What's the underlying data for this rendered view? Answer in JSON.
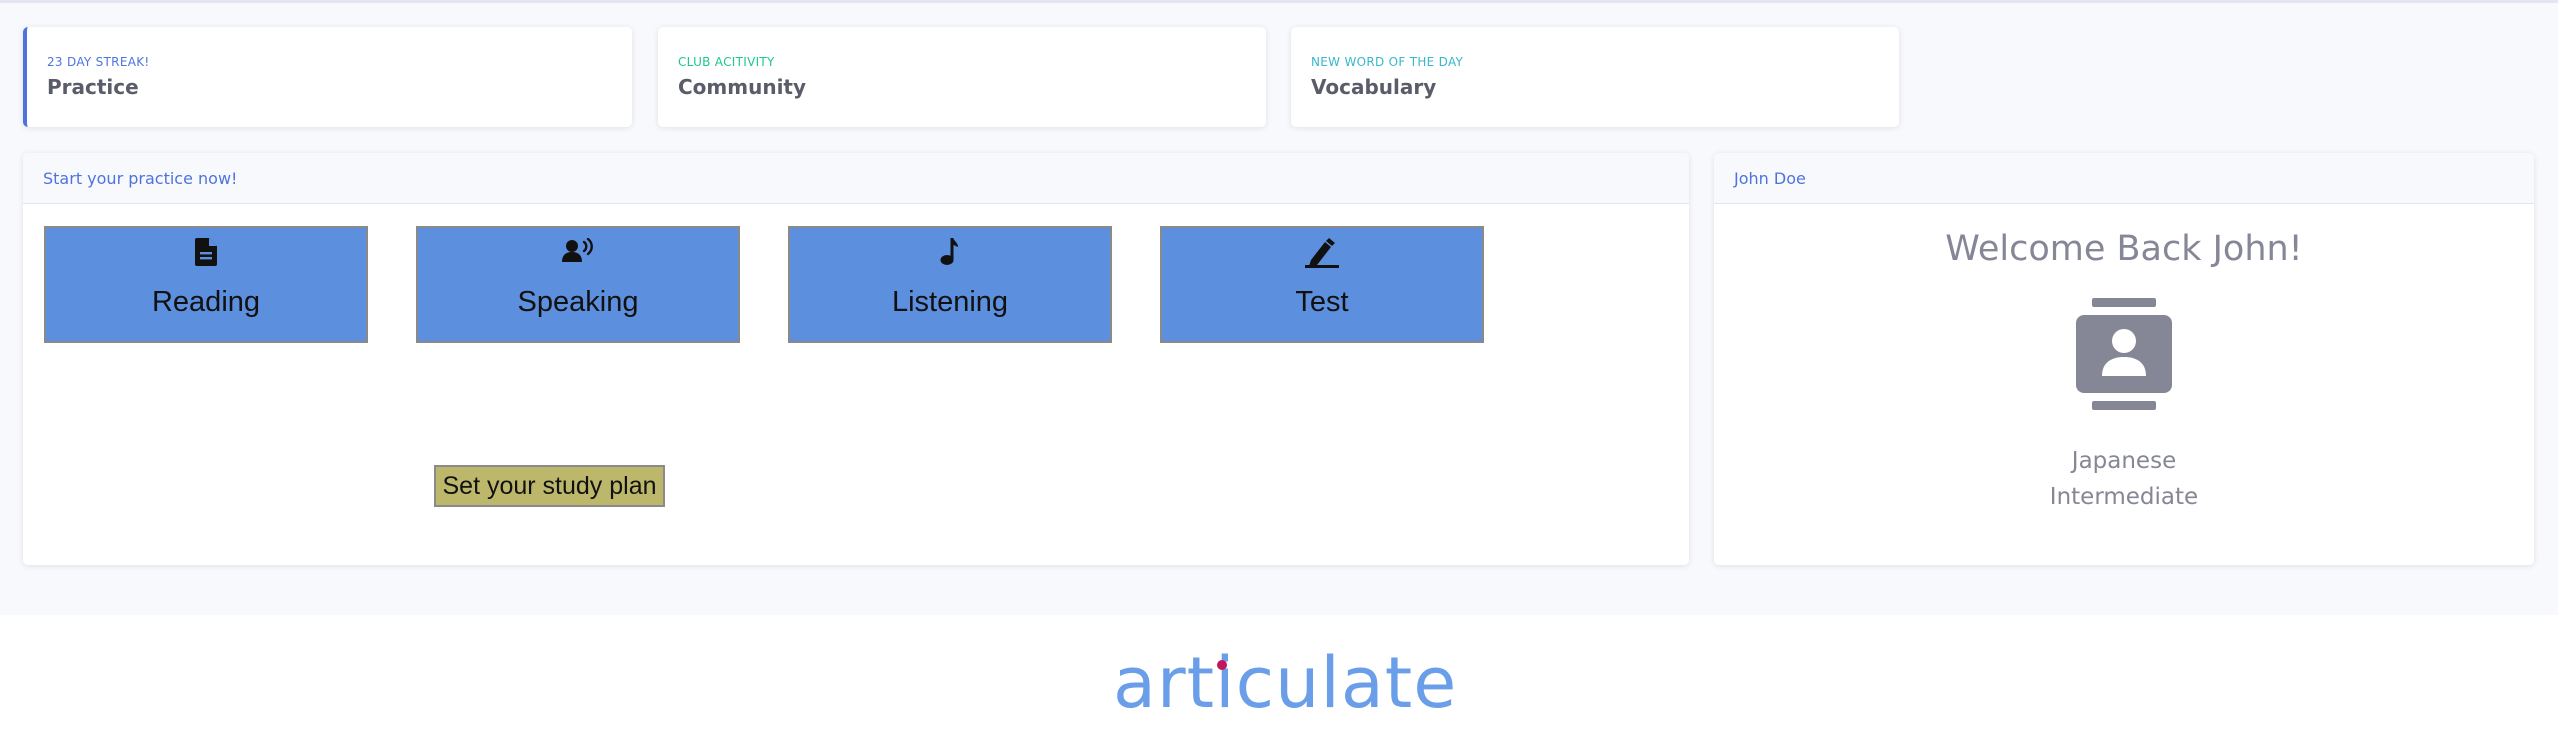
{
  "stats": [
    {
      "small": "23 DAY STREAK!",
      "big": "Practice",
      "small_color": "#4e73df"
    },
    {
      "small": "CLUB ACITIVITY",
      "big": "Community",
      "small_color": "#1cc88a"
    },
    {
      "small": "NEW WORD OF THE DAY",
      "big": "Vocabulary",
      "small_color": "#36b9cc"
    }
  ],
  "practice": {
    "header": "Start your practice now!",
    "skills": [
      {
        "label": "Reading",
        "icon": "document-icon"
      },
      {
        "label": "Speaking",
        "icon": "speaking-person-icon"
      },
      {
        "label": "Listening",
        "icon": "music-note-icon"
      },
      {
        "label": "Test",
        "icon": "pen-icon"
      }
    ],
    "plan_button": "Set your study plan"
  },
  "profile": {
    "header": "John Doe",
    "welcome": "Welcome Back John!",
    "icon": "contact-card-icon",
    "language": "Japanese",
    "level": "Intermediate"
  },
  "footer": {
    "logo_text": "articulate",
    "colors": {
      "logo": "#6b9ee8",
      "logo_dot": "#c2185b"
    }
  },
  "colors": {
    "primary": "#4e73df",
    "skill_button": "#5d8fdf",
    "plan_button": "#bdb76b"
  }
}
